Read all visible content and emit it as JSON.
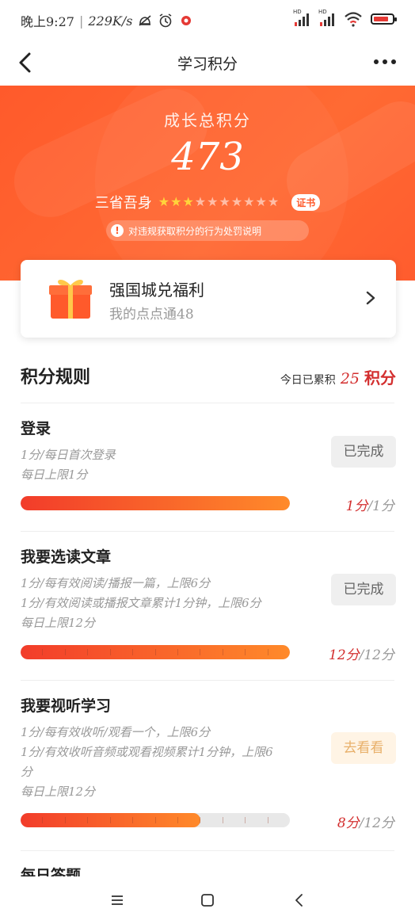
{
  "status_bar": {
    "time": "晚上9:27",
    "speed": "229K/s",
    "sim_label": "HD",
    "icons": [
      "mute-icon",
      "alarm-icon",
      "notification-icon",
      "signal-icon",
      "signal-icon",
      "wifi-icon",
      "battery-icon"
    ]
  },
  "nav": {
    "title": "学习积分"
  },
  "hero": {
    "label": "成长总积分",
    "score": "473",
    "stars_label": "三省吾身",
    "stars_total": 10,
    "stars_filled": 3,
    "certificate": "证书",
    "notice": "对违规获取积分的行为处罚说明",
    "accent_color": "#ff5a2b"
  },
  "reward": {
    "title": "强国城兑福利",
    "subtitle": "我的点点通48"
  },
  "rules_header": {
    "title": "积分规则",
    "today_label": "今日已累积",
    "today_value": "25",
    "today_unit": "积分"
  },
  "rules": [
    {
      "name": "登录",
      "desc": [
        "1分/每日首次登录",
        "每日上限1分"
      ],
      "button": "已完成",
      "button_state": "done",
      "got": "1分",
      "max": "/1分",
      "progress": 1.0,
      "segments": 1
    },
    {
      "name": "我要选读文章",
      "desc": [
        "1分/每有效阅读/播报一篇，上限6分",
        "1分/有效阅读或播报文章累计1分钟，上限6分",
        "每日上限12分"
      ],
      "button": "已完成",
      "button_state": "done",
      "got": "12分",
      "max": "/12分",
      "progress": 1.0,
      "segments": 12
    },
    {
      "name": "我要视听学习",
      "desc": [
        "1分/每有效收听/观看一个，上限6分",
        "1分/有效收听音频或观看视频累计1分钟，上限6",
        "分",
        "每日上限12分"
      ],
      "button": "去看看",
      "button_state": "todo",
      "got": "8分",
      "max": "/12分",
      "progress": 0.6667,
      "segments": 12
    },
    {
      "name": "每日答题",
      "desc": [],
      "button": "",
      "button_state": "hidden",
      "got": "",
      "max": "",
      "progress": 0,
      "segments": 0
    }
  ]
}
